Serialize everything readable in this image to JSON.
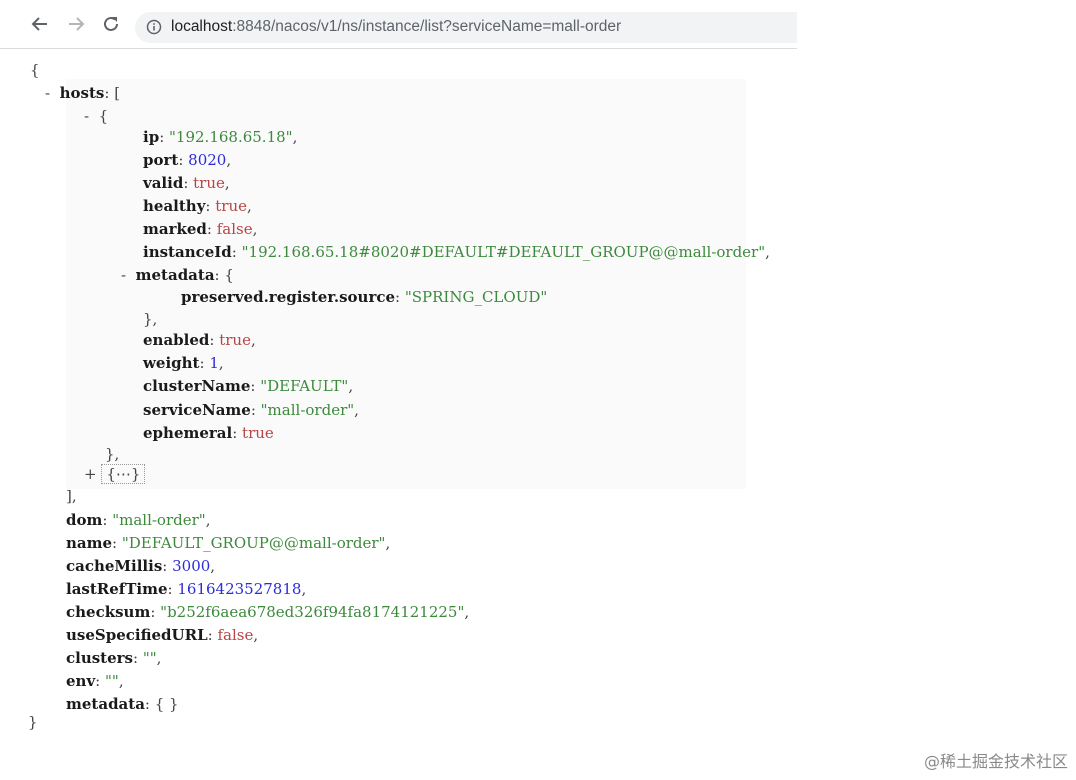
{
  "browser": {
    "url_host": "localhost",
    "url_rest": ":8848/nacos/v1/ns/instance/list?serviceName=mall-order",
    "icons": [
      "back-arrow-icon",
      "forward-arrow-icon",
      "reload-icon",
      "info-icon"
    ]
  },
  "json": {
    "open_brace": "{",
    "hosts_toggle": "-",
    "hosts_key": "hosts",
    "hosts_open": "[",
    "item_toggle": "-",
    "item_open": "{",
    "ip_key": "ip",
    "ip_val": "\"192.168.65.18\"",
    "port_key": "port",
    "port_val": "8020",
    "valid_key": "valid",
    "valid_val": "true",
    "healthy_key": "healthy",
    "healthy_val": "true",
    "marked_key": "marked",
    "marked_val": "false",
    "instanceId_key": "instanceId",
    "instanceId_val": "\"192.168.65.18#8020#DEFAULT#DEFAULT_GROUP@@mall-order\"",
    "metadata_toggle": "-",
    "metadata_key": "metadata",
    "metadata_open": "{",
    "preserved_key": "preserved.register.source",
    "preserved_val": "\"SPRING_CLOUD\"",
    "metadata_close": "},",
    "enabled_key": "enabled",
    "enabled_val": "true",
    "weight_key": "weight",
    "weight_val": "1",
    "clusterName_key": "clusterName",
    "clusterName_val": "\"DEFAULT\"",
    "serviceName_key": "serviceName",
    "serviceName_val": "\"mall-order\"",
    "ephemeral_key": "ephemeral",
    "ephemeral_val": "true",
    "item_close": "},",
    "collapsed_toggle": "+",
    "collapsed_label": "{⋯}",
    "hosts_close": "],",
    "dom_key": "dom",
    "dom_val": "\"mall-order\"",
    "name_key": "name",
    "name_val": "\"DEFAULT_GROUP@@mall-order\"",
    "cacheMillis_key": "cacheMillis",
    "cacheMillis_val": "3000",
    "lastRefTime_key": "lastRefTime",
    "lastRefTime_val": "1616423527818",
    "checksum_key": "checksum",
    "checksum_val": "\"b252f6aea678ed326f94fa8174121225\"",
    "useSpecifiedURL_key": "useSpecifiedURL",
    "useSpecifiedURL_val": "false",
    "clusters_key": "clusters",
    "clusters_val": "\"\"",
    "env_key": "env",
    "env_val": "\"\"",
    "metadata2_key": "metadata",
    "metadata2_val": "{ }",
    "close_brace": "}"
  },
  "watermark": "@稀土掘金技术社区"
}
